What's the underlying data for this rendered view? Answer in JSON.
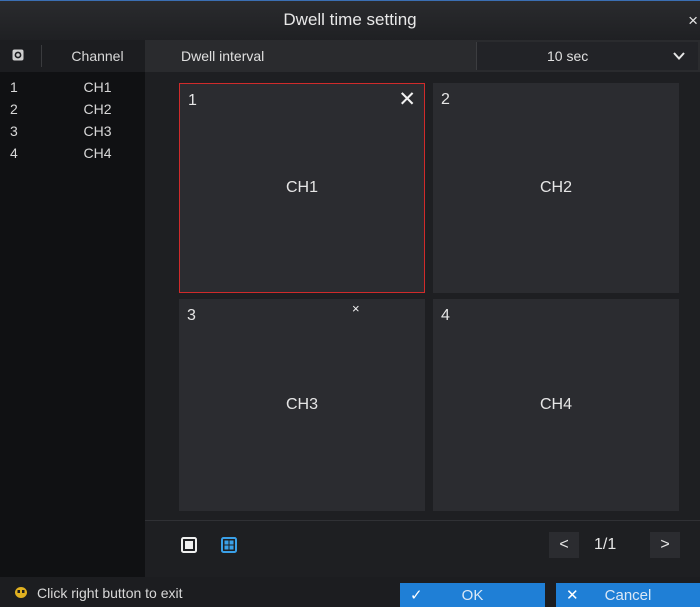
{
  "dialog": {
    "title": "Dwell time setting",
    "close_glyph": "×"
  },
  "channel_list": {
    "header_icon": "camera-icon",
    "column_label": "Channel",
    "rows": [
      {
        "num": "1",
        "name": "CH1"
      },
      {
        "num": "2",
        "name": "CH2"
      },
      {
        "num": "3",
        "name": "CH3"
      },
      {
        "num": "4",
        "name": "CH4"
      }
    ]
  },
  "dwell": {
    "label": "Dwell interval",
    "selected_value": "10 sec"
  },
  "panes": [
    {
      "num": "1",
      "channel": "CH1",
      "selected": true
    },
    {
      "num": "2",
      "channel": "CH2",
      "selected": false
    },
    {
      "num": "3",
      "channel": "CH3",
      "selected": false
    },
    {
      "num": "4",
      "channel": "CH4",
      "selected": false
    }
  ],
  "pane_close_glyph": "✕",
  "pane_close_small_glyph": "×",
  "pager": {
    "prev": "<",
    "text": "1/1",
    "next": ">"
  },
  "footer": {
    "hint": "Click right button to exit",
    "ok_glyph": "✓",
    "ok_label": "OK",
    "cancel_glyph": "✕",
    "cancel_label": "Cancel"
  },
  "colors": {
    "accent": "#1f7fd6",
    "selection_border": "#d02b2b",
    "active_layout_icon": "#3aa0e8"
  }
}
